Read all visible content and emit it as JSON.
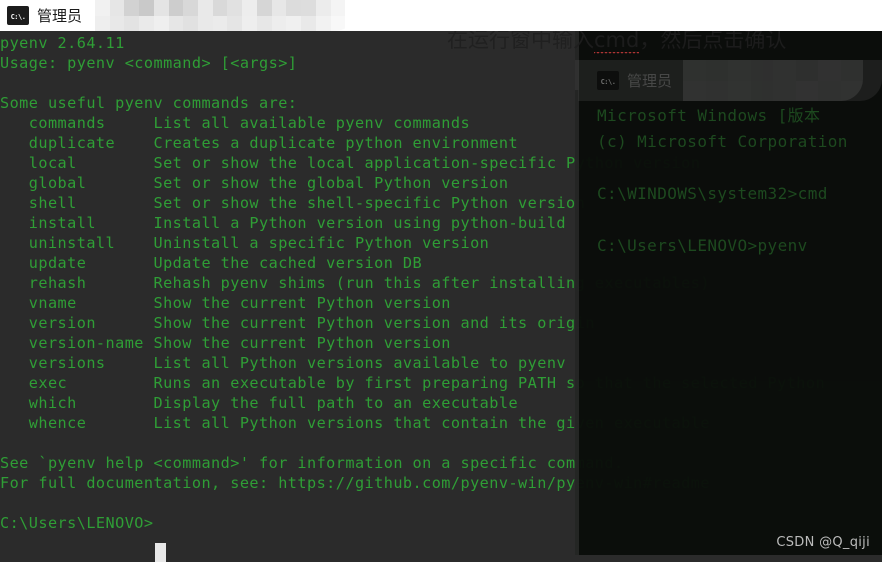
{
  "window": {
    "icon": "cmd-console-icon",
    "icon_glyph": "C:\\.",
    "title": "管理员",
    "redacted_title_note": ""
  },
  "terminal": {
    "background_color": "#2b2b2b",
    "text_color": "#2f9e36",
    "cursor_color": "#e8e8e8",
    "content": "pyenv 2.64.11\nUsage: pyenv <command> [<args>]\n\nSome useful pyenv commands are:\n   commands     List all available pyenv commands\n   duplicate    Creates a duplicate python environment\n   local        Set or show the local application-specific Python version\n   global       Set or show the global Python version\n   shell        Set or show the shell-specific Python version\n   install      Install a Python version using python-build\n   uninstall    Uninstall a specific Python version\n   update       Update the cached version DB\n   rehash       Rehash pyenv shims (run this after installing executables)\n   vname        Show the current Python version\n   version      Show the current Python version and its origin\n   version-name Show the current Python version\n   versions     List all Python versions available to pyenv\n   exec         Runs an executable by first preparing PATH so that the selected Python\n   which        Display the full path to an executable\n   whence       List all Python versions that contain the given executable\n\nSee `pyenv help <command>' for information on a specific command.\nFor full documentation, see: https://github.com/pyenv-win/pyenv-win#readme\n\nC:\\Users\\LENOVO>",
    "version_line": "pyenv 2.64.11",
    "usage_line": "Usage: pyenv <command> [<args>]",
    "section_heading": "Some useful pyenv commands are:",
    "commands": [
      {
        "name": "commands",
        "description": "List all available pyenv commands"
      },
      {
        "name": "duplicate",
        "description": "Creates a duplicate python environment"
      },
      {
        "name": "local",
        "description": "Set or show the local application-specific Python version"
      },
      {
        "name": "global",
        "description": "Set or show the global Python version"
      },
      {
        "name": "shell",
        "description": "Set or show the shell-specific Python version"
      },
      {
        "name": "install",
        "description": "Install a Python version using python-build"
      },
      {
        "name": "uninstall",
        "description": "Uninstall a specific Python version"
      },
      {
        "name": "update",
        "description": "Update the cached version DB"
      },
      {
        "name": "rehash",
        "description": "Rehash pyenv shims (run this after installing executables)"
      },
      {
        "name": "vname",
        "description": "Show the current Python version"
      },
      {
        "name": "version",
        "description": "Show the current Python version and its origin"
      },
      {
        "name": "version-name",
        "description": "Show the current Python version"
      },
      {
        "name": "versions",
        "description": "List all Python versions available to pyenv"
      },
      {
        "name": "exec",
        "description": "Runs an executable by first preparing PATH so that the selected Python"
      },
      {
        "name": "which",
        "description": "Display the full path to an executable"
      },
      {
        "name": "whence",
        "description": "List all Python versions that contain the given executable"
      }
    ],
    "help_hint": "See `pyenv help <command>' for information on a specific command.",
    "docs_hint": "For full documentation, see: https://github.com/pyenv-win/pyenv-win#readme",
    "prompt": "C:\\Users\\LENOVO>"
  },
  "annotation": {
    "prefix": "在运行窗中输入",
    "misspelled": "cmd",
    "suffix": "，然后点击确认",
    "full_text": "在运行窗中输入cmd，然后点击确认",
    "color": "#1f1f1f"
  },
  "ghost_overlay": {
    "title": "管理员",
    "icon_glyph": "C:\\.",
    "content": "Microsoft Windows [版本\n(c) Microsoft Corporation\n\nC:\\WINDOWS\\system32>cmd\n\nC:\\Users\\LENOVO>pyenv",
    "lines": [
      "Microsoft Windows [版本",
      "(c) Microsoft Corporation",
      "",
      "C:\\WINDOWS\\system32>cmd",
      "",
      "C:\\Users\\LENOVO>pyenv"
    ]
  },
  "watermark": {
    "text": "CSDN @Q_qiji"
  }
}
